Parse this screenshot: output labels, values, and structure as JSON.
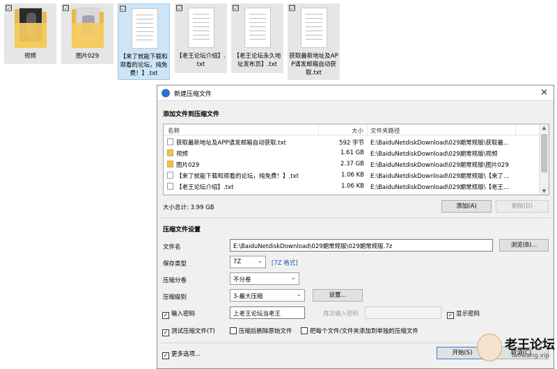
{
  "desktop": {
    "files": [
      {
        "name": "视频",
        "kind": "folder",
        "checked": "☑"
      },
      {
        "name": "图片029",
        "kind": "folder",
        "checked": "☑"
      },
      {
        "name": "【来了就能下载和观看的论坛，纯免费！】.txt",
        "kind": "text",
        "checked": "☑"
      },
      {
        "name": "【老王论坛介绍】.txt",
        "kind": "text",
        "checked": "☑"
      },
      {
        "name": "【老王论坛永久地址发布页】.txt",
        "kind": "text",
        "checked": "☑"
      },
      {
        "name": "获取最新地址及APP请发邮箱自动获取.txt",
        "kind": "text",
        "checked": "☑"
      }
    ]
  },
  "dialog": {
    "title": "新建压缩文件",
    "close_glyph": "✕",
    "add_section": "添加文件到压缩文件",
    "columns": {
      "name": "名称",
      "size": "大小",
      "path": "文件夹路径"
    },
    "rows": [
      {
        "name": "获取最新地址及APP请发邮箱自动获取.txt",
        "size": "592 字节",
        "path": "E:\\BaiduNetdiskDownload\\029期常规版\\获取最...",
        "kind": "file"
      },
      {
        "name": "视频",
        "size": "1.61 GB",
        "path": "E:\\BaiduNetdiskDownload\\029期常规版\\视频",
        "kind": "folder"
      },
      {
        "name": "图片029",
        "size": "2.37 GB",
        "path": "E:\\BaiduNetdiskDownload\\029期常规版\\图片029",
        "kind": "folder"
      },
      {
        "name": "【来了就能下载和观看的论坛，纯免费！】.txt",
        "size": "1.06 KB",
        "path": "E:\\BaiduNetdiskDownload\\029期常规版\\【来了...",
        "kind": "file"
      },
      {
        "name": "【老王论坛介绍】.txt",
        "size": "1.06 KB",
        "path": "E:\\BaiduNetdiskDownload\\029期常规版\\【老王...",
        "kind": "file"
      }
    ],
    "total_size": "大小总计: 3.99 GB",
    "add_button": "添加(A)",
    "delete_button": "删除(D)",
    "settings_section": "压缩文件设置",
    "filename_label": "文件名",
    "filename_value": "E:\\BaiduNetdiskDownload\\029期常规版\\029期常规版.7z",
    "browse_button": "浏览(B)...",
    "save_type_label": "保存类型",
    "save_type_value": "7Z",
    "format_link": "[7Z 格式]",
    "volume_label": "压缩分卷",
    "volume_value": "不分卷",
    "level_label": "压缩级别",
    "level_value": "3-最大压缩",
    "settings_button": "设置...",
    "password_checkbox": "输入密码",
    "password_value": "上老王论坛当老王",
    "reenter_label": "再次输入密码",
    "show_password": "显示密码",
    "test_archive": "测试压缩文件(T)",
    "delete_after": "压缩后删除原始文件",
    "each_file": "把每个文件/文件夹添加到单独的压缩文件",
    "more_options": "更多选项...",
    "start_button": "开始(S)",
    "cancel_button": "取消(C)",
    "check_on": "✓",
    "chevron": "⌄",
    "scroll_up": "▲",
    "scroll_down": "▼"
  },
  "watermark": {
    "text": "老王论坛",
    "url": "laowang.vip"
  }
}
